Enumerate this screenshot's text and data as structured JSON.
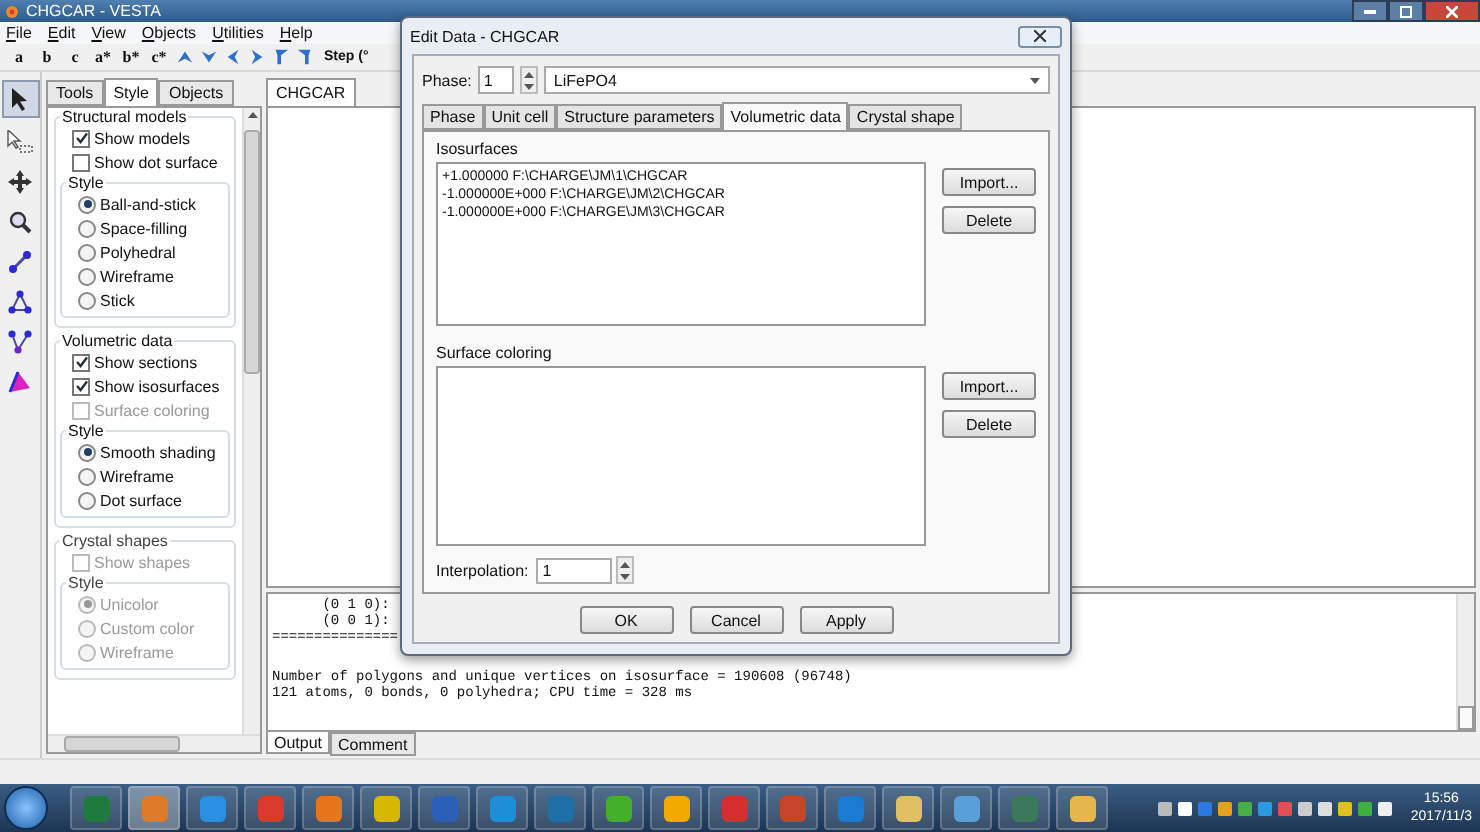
{
  "window": {
    "title": "CHGCAR - VESTA"
  },
  "menu": [
    "File",
    "Edit",
    "View",
    "Objects",
    "Utilities",
    "Help"
  ],
  "toolbar": {
    "axis_buttons": [
      "a",
      "b",
      "c",
      "a*",
      "b*",
      "c*"
    ],
    "step_label": "Step (°"
  },
  "side_panel": {
    "tabs": [
      {
        "label": "Tools",
        "selected": false
      },
      {
        "label": "Style",
        "selected": true
      },
      {
        "label": "Objects",
        "selected": false
      }
    ],
    "groups": [
      {
        "title": "Structural models",
        "disabled": false,
        "checks": [
          {
            "label": "Show models",
            "checked": true,
            "disabled": false
          },
          {
            "label": "Show dot surface",
            "checked": false,
            "disabled": false
          }
        ],
        "style": {
          "title": "Style",
          "options": [
            {
              "label": "Ball-and-stick",
              "selected": true
            },
            {
              "label": "Space-filling",
              "selected": false
            },
            {
              "label": "Polyhedral",
              "selected": false
            },
            {
              "label": "Wireframe",
              "selected": false
            },
            {
              "label": "Stick",
              "selected": false
            }
          ]
        }
      },
      {
        "title": "Volumetric data",
        "disabled": false,
        "checks": [
          {
            "label": "Show sections",
            "checked": true,
            "disabled": false
          },
          {
            "label": "Show isosurfaces",
            "checked": true,
            "disabled": false
          },
          {
            "label": "Surface coloring",
            "checked": false,
            "disabled": true
          }
        ],
        "style": {
          "title": "Style",
          "options": [
            {
              "label": "Smooth shading",
              "selected": true
            },
            {
              "label": "Wireframe",
              "selected": false
            },
            {
              "label": "Dot surface",
              "selected": false
            }
          ]
        }
      },
      {
        "title": "Crystal shapes",
        "disabled": true,
        "checks": [
          {
            "label": "Show shapes",
            "checked": false,
            "disabled": true
          }
        ],
        "style": {
          "title": "Style",
          "options": [
            {
              "label": "Unicolor",
              "selected": true
            },
            {
              "label": "Custom color",
              "selected": false
            },
            {
              "label": "Wireframe",
              "selected": false
            }
          ]
        }
      }
    ]
  },
  "viewer": {
    "tabs": [
      {
        "label": "CHGCAR",
        "selected": true
      }
    ]
  },
  "output": {
    "lines_top": [
      "      (0 1 0):",
      "      (0 0 1):",
      "==============="
    ],
    "lines_bottom": [
      "Number of polygons and unique vertices on isosurface = 190608 (96748)",
      "121 atoms, 0 bonds, 0 polyhedra; CPU time = 328 ms"
    ],
    "tabs": [
      {
        "label": "Output",
        "selected": true
      },
      {
        "label": "Comment",
        "selected": false
      }
    ]
  },
  "dialog": {
    "title": "Edit Data - CHGCAR",
    "phase_label": "Phase:",
    "phase_value": "1",
    "phase_name": "LiFePO4",
    "tabs": [
      {
        "label": "Phase",
        "selected": false
      },
      {
        "label": "Unit cell",
        "selected": false
      },
      {
        "label": "Structure parameters",
        "selected": false
      },
      {
        "label": "Volumetric data",
        "selected": true
      },
      {
        "label": "Crystal shape",
        "selected": false
      }
    ],
    "lists": [
      {
        "title": "Isosurfaces",
        "items": [
          "+1.000000 F:\\CHARGE\\JM\\1\\CHGCAR",
          "-1.000000E+000 F:\\CHARGE\\JM\\2\\CHGCAR",
          "-1.000000E+000 F:\\CHARGE\\JM\\3\\CHGCAR"
        ],
        "buttons": [
          "Import...",
          "Delete"
        ]
      },
      {
        "title": "Surface coloring",
        "buttons": [
          "Import...",
          "Delete"
        ]
      }
    ],
    "interpolation_label": "Interpolation:",
    "interpolation_value": "1",
    "buttons": [
      "OK",
      "Cancel",
      "Apply"
    ]
  },
  "taskbar": {
    "time": "15:56",
    "date": "2017/11/3"
  }
}
